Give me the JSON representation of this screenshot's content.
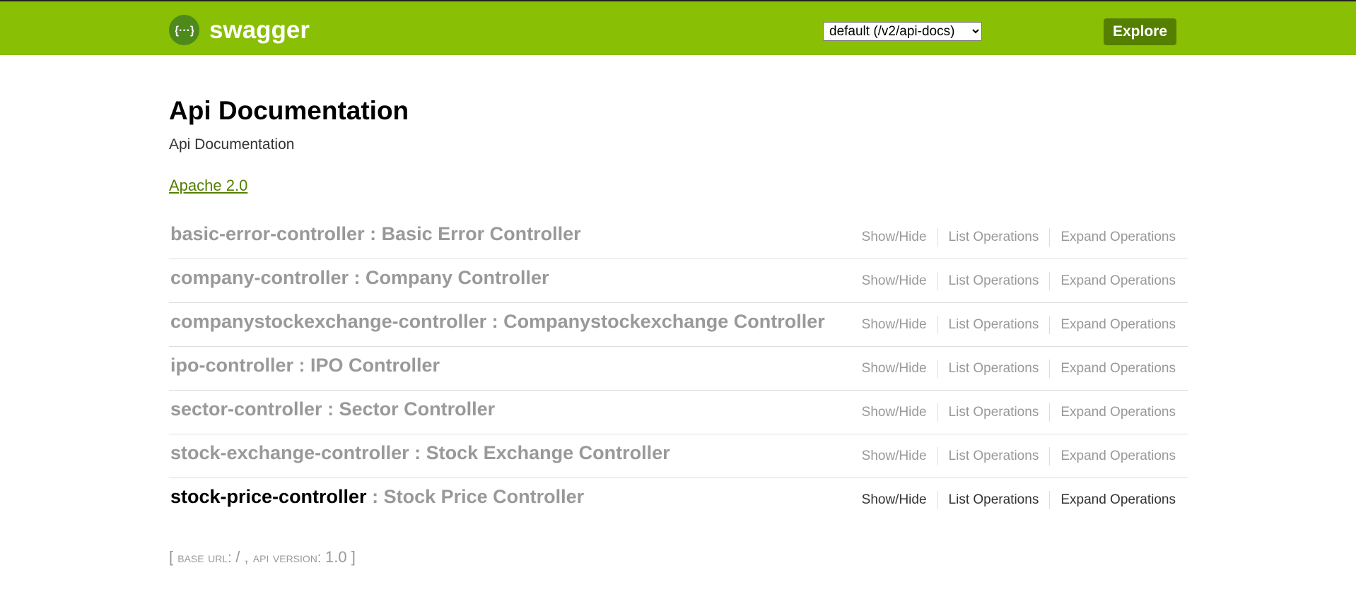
{
  "header": {
    "logo_text": "swagger",
    "logo_icon": "swagger-braces-icon",
    "spec_select": {
      "selected": "default (/v2/api-docs)",
      "options": [
        "default (/v2/api-docs)"
      ]
    },
    "explore_label": "Explore"
  },
  "colors": {
    "header_bg": "#89bf04",
    "explore_bg": "#547f00",
    "link": "#547f00",
    "muted": "#999999"
  },
  "info": {
    "title": "Api Documentation",
    "description": "Api Documentation",
    "license": "Apache 2.0"
  },
  "resources": [
    {
      "name": "basic-error-controller",
      "desc": " : Basic Error Controller"
    },
    {
      "name": "company-controller",
      "desc": " : Company Controller"
    },
    {
      "name": "companystockexchange-controller",
      "desc": " : Companystockexchange Controller"
    },
    {
      "name": "ipo-controller",
      "desc": " : IPO Controller"
    },
    {
      "name": "sector-controller",
      "desc": " : Sector Controller"
    },
    {
      "name": "stock-exchange-controller",
      "desc": " : Stock Exchange Controller"
    },
    {
      "name": "stock-price-controller",
      "desc": " : Stock Price Controller"
    }
  ],
  "resource_ops": {
    "show_hide": "Show/Hide",
    "list_operations": "List Operations",
    "expand_operations": "Expand Operations"
  },
  "footer": {
    "open_bracket": "[",
    "base_url_label": "base url",
    "base_url_value": "/",
    "api_version_label": "api version",
    "api_version_value": "1.0",
    "close_bracket": "]"
  }
}
